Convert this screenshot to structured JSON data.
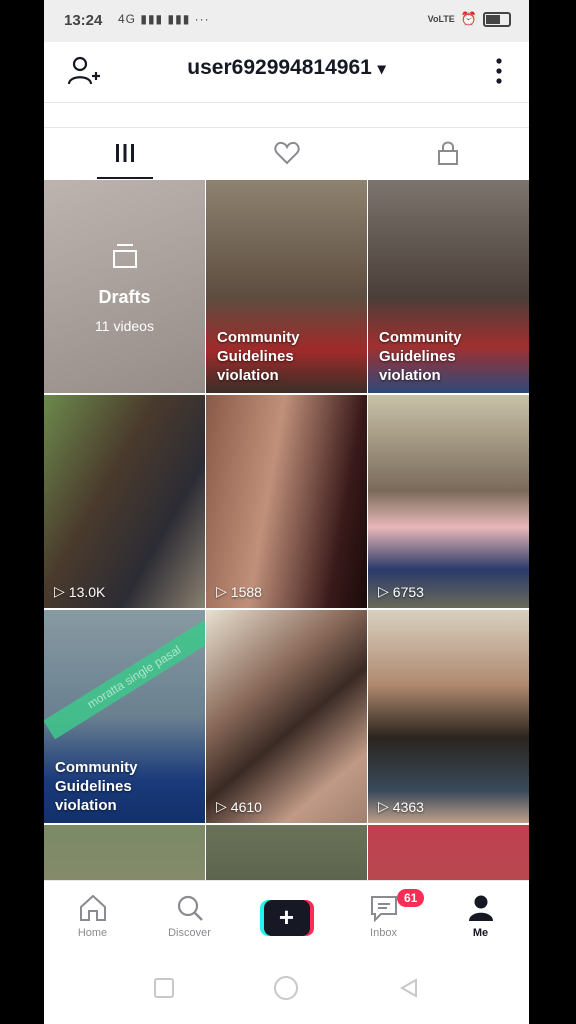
{
  "status": {
    "time": "13:24",
    "signal": "4G",
    "more": "···",
    "right": "VoLTE"
  },
  "header": {
    "username": "user692994814961",
    "dropdown": "▾"
  },
  "tabs": [
    {
      "name": "videos",
      "icon": "grid-bars-icon",
      "active": true
    },
    {
      "name": "liked",
      "icon": "heart-icon",
      "active": false
    },
    {
      "name": "private",
      "icon": "lock-icon",
      "active": false
    }
  ],
  "drafts": {
    "title": "Drafts",
    "count": "11 videos"
  },
  "grid": [
    {
      "type": "drafts",
      "bg": "#7a6a62"
    },
    {
      "type": "violation",
      "text": "Community\nGuidelines\nviolation",
      "bg": "#6d6155"
    },
    {
      "type": "violation",
      "text": "Community\nGuidelines\nviolation",
      "bg": "#5d5552"
    },
    {
      "type": "views",
      "views": "13.0K",
      "bg": "#5a6a4a"
    },
    {
      "type": "views",
      "views": "1588",
      "bg": "#6b3a36"
    },
    {
      "type": "views",
      "views": "6753",
      "bg": "#8e8878"
    },
    {
      "type": "violation",
      "text": "Community\nGuidelines\nviolation",
      "bg": "#5e7480",
      "tag": "moratta single pasal"
    },
    {
      "type": "views",
      "views": "4610",
      "bg": "#a48270"
    },
    {
      "type": "views",
      "views": "4363",
      "bg": "#9b8572"
    },
    {
      "type": "partial",
      "bg": "#7b8a66"
    },
    {
      "type": "partial",
      "bg": "#6a7358"
    },
    {
      "type": "partial",
      "bg": "#c04050"
    }
  ],
  "nav": {
    "home": "Home",
    "discover": "Discover",
    "create": "+",
    "inbox": "Inbox",
    "inbox_badge": "61",
    "me": "Me"
  },
  "colors": {
    "accent": "#fe2c55",
    "cyan": "#25f4ee",
    "text": "#161823"
  }
}
